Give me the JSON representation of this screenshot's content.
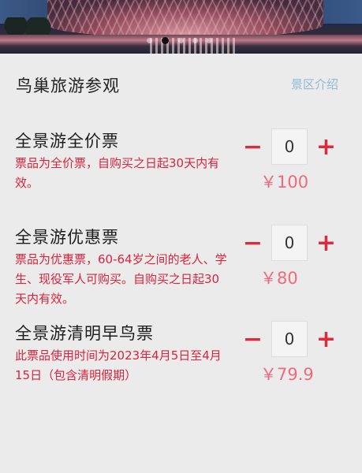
{
  "banner": {
    "carousel_total": 5,
    "carousel_active": 1
  },
  "header": {
    "title": "鸟巢旅游参观",
    "intro_link": "景区介绍"
  },
  "tickets": [
    {
      "name": "全景游全价票",
      "desc": "票品为全价票，自购买之日起30天内有效。",
      "quantity": "0",
      "price": "￥100"
    },
    {
      "name": "全景游优惠票",
      "desc": "票品为优惠票，60-64岁之间的老人、学生、现役军人可购买。自购买之日起30天内有效。",
      "quantity": "0",
      "price": "￥80"
    },
    {
      "name": "全景游清明早鸟票",
      "desc": "此票品使用时间为2023年4月5日至4月15日（包含清明假期）",
      "quantity": "0",
      "price": "￥79.9"
    }
  ],
  "stepper": {
    "minus": "−",
    "plus": "+"
  },
  "colors": {
    "accent_red": "#e0283e",
    "price_pink": "#f06a7c",
    "link_blue": "#8fb8d8",
    "bg": "#ebebeb"
  }
}
